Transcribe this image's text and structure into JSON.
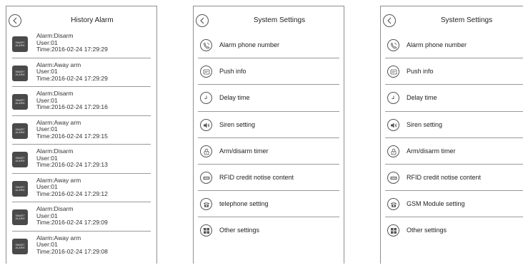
{
  "panel1": {
    "title": "History Alarm",
    "icon_text": [
      "SMART",
      "ALARM"
    ],
    "items": [
      {
        "alarm": "Alarm:Disarm",
        "user": "User:01",
        "time": "Time:2016-02-24 17:29:29"
      },
      {
        "alarm": "Alarm:Away arm",
        "user": "User:01",
        "time": "Time:2016-02-24 17:29:29"
      },
      {
        "alarm": "Alarm:Disarm",
        "user": "User:01",
        "time": "Time:2016-02-24 17:29:16"
      },
      {
        "alarm": "Alarm:Away arm",
        "user": "User:01",
        "time": "Time:2016-02-24 17:29:15"
      },
      {
        "alarm": "Alarm:Disarm",
        "user": "User:01",
        "time": "Time:2016-02-24 17:29:13"
      },
      {
        "alarm": "Alarm:Away arm",
        "user": "User:01",
        "time": "Time:2016-02-24 17:29:12"
      },
      {
        "alarm": "Alarm:Disarm",
        "user": "User:01",
        "time": "Time:2016-02-24 17:29:09"
      },
      {
        "alarm": "Alarm:Away arm",
        "user": "User:01",
        "time": "Time:2016-02-24 17:29:08"
      }
    ]
  },
  "panel2": {
    "title": "System Settings",
    "items": [
      {
        "label": "Alarm phone number",
        "icon": "phone-icon"
      },
      {
        "label": "Push info",
        "icon": "message-icon"
      },
      {
        "label": "Delay time",
        "icon": "clock-icon"
      },
      {
        "label": "Siren setting",
        "icon": "speaker-icon"
      },
      {
        "label": "Arm/disarm timer",
        "icon": "lock-icon"
      },
      {
        "label": "RFID credit notise content",
        "icon": "rfid-card-icon"
      },
      {
        "label": "telephone setting",
        "icon": "telephone-icon"
      },
      {
        "label": "Other settings",
        "icon": "grid-icon"
      }
    ]
  },
  "panel3": {
    "title": "System Settings",
    "items": [
      {
        "label": "Alarm phone number",
        "icon": "phone-icon"
      },
      {
        "label": "Push info",
        "icon": "message-icon"
      },
      {
        "label": "Delay time",
        "icon": "clock-icon"
      },
      {
        "label": "Siren setting",
        "icon": "speaker-icon"
      },
      {
        "label": "Arm/disarm timer",
        "icon": "lock-icon"
      },
      {
        "label": "RFID credit notise content",
        "icon": "rfid-card-icon"
      },
      {
        "label": "GSM Module setting",
        "icon": "telephone-icon"
      },
      {
        "label": "Other settings",
        "icon": "grid-icon"
      }
    ]
  }
}
